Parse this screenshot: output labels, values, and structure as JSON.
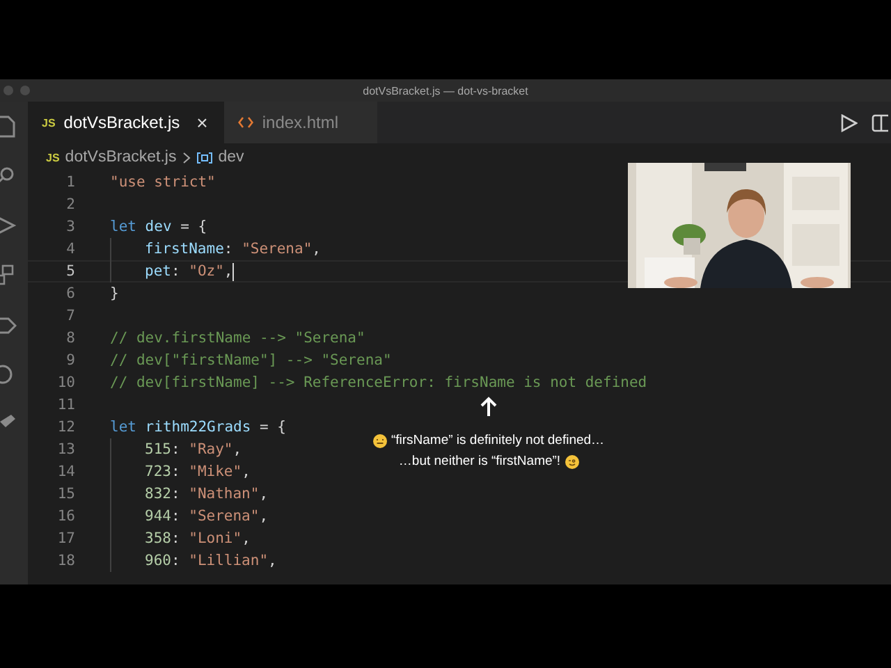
{
  "window": {
    "title": "dotVsBracket.js — dot-vs-bracket"
  },
  "tabs": [
    {
      "icon": "JS",
      "kind": "js",
      "label": "dotVsBracket.js",
      "selected": true,
      "close": "×"
    },
    {
      "kind": "html",
      "label": "index.html",
      "selected": false
    }
  ],
  "breadcrumb": {
    "file_icon": "JS",
    "file": "dotVsBracket.js",
    "symbol": "dev"
  },
  "editor": {
    "lines": [
      {
        "number": "1",
        "current": false,
        "indented": false,
        "tokens": [
          {
            "t": "\"use strict\"",
            "kind": "string"
          }
        ]
      },
      {
        "number": "2",
        "current": false
      },
      {
        "number": "3",
        "current": false,
        "indented": false,
        "tokens": [
          {
            "t": "let ",
            "kind": "keyword"
          },
          {
            "t": "dev",
            "kind": "var"
          },
          {
            "t": " = {",
            "kind": "punct"
          }
        ]
      },
      {
        "number": "4",
        "current": false,
        "indented": true,
        "tokens": [
          {
            "t": "firstName",
            "kind": "var"
          },
          {
            "t": ": ",
            "kind": "punct"
          },
          {
            "t": "\"Serena\"",
            "kind": "string"
          },
          {
            "t": ",",
            "kind": "punct"
          }
        ]
      },
      {
        "number": "5",
        "current": true,
        "indented": true,
        "tokens": [
          {
            "t": "pet",
            "kind": "var"
          },
          {
            "t": ": ",
            "kind": "punct"
          },
          {
            "t": "\"Oz\"",
            "kind": "string"
          },
          {
            "t": ",",
            "kind": "punct"
          }
        ]
      },
      {
        "number": "6",
        "current": false,
        "indented": false,
        "tokens": [
          {
            "t": "}",
            "kind": "punct"
          }
        ]
      },
      {
        "number": "7",
        "current": false
      },
      {
        "number": "8",
        "current": false,
        "indented": false,
        "tokens": [
          {
            "t": "// dev.firstName --> \"Serena\"",
            "kind": "comment"
          }
        ]
      },
      {
        "number": "9",
        "current": false,
        "indented": false,
        "tokens": [
          {
            "t": "// dev[\"firstName\"] --> \"Serena\"",
            "kind": "comment"
          }
        ]
      },
      {
        "number": "10",
        "current": false,
        "indented": false,
        "tokens": [
          {
            "t": "// dev[firstName] --> ReferenceError: firsName is not defined",
            "kind": "comment"
          }
        ]
      },
      {
        "number": "11",
        "current": false
      },
      {
        "number": "12",
        "current": false,
        "indented": false,
        "tokens": [
          {
            "t": "let ",
            "kind": "keyword"
          },
          {
            "t": "rithm22Grads",
            "kind": "var"
          },
          {
            "t": " = {",
            "kind": "punct"
          }
        ]
      },
      {
        "number": "13",
        "current": false,
        "indented": true,
        "tokens": [
          {
            "t": "515",
            "kind": "number"
          },
          {
            "t": ": ",
            "kind": "punct"
          },
          {
            "t": "\"Ray\"",
            "kind": "string"
          },
          {
            "t": ",",
            "kind": "punct"
          }
        ]
      },
      {
        "number": "14",
        "current": false,
        "indented": true,
        "tokens": [
          {
            "t": "723",
            "kind": "number"
          },
          {
            "t": ": ",
            "kind": "punct"
          },
          {
            "t": "\"Mike\"",
            "kind": "string"
          },
          {
            "t": ",",
            "kind": "punct"
          }
        ]
      },
      {
        "number": "15",
        "current": false,
        "indented": true,
        "tokens": [
          {
            "t": "832",
            "kind": "number"
          },
          {
            "t": ": ",
            "kind": "punct"
          },
          {
            "t": "\"Nathan\"",
            "kind": "string"
          },
          {
            "t": ",",
            "kind": "punct"
          }
        ]
      },
      {
        "number": "16",
        "current": false,
        "indented": true,
        "tokens": [
          {
            "t": "944",
            "kind": "number"
          },
          {
            "t": ": ",
            "kind": "punct"
          },
          {
            "t": "\"Serena\"",
            "kind": "string"
          },
          {
            "t": ",",
            "kind": "punct"
          }
        ]
      },
      {
        "number": "17",
        "current": false,
        "indented": true,
        "tokens": [
          {
            "t": "358",
            "kind": "number"
          },
          {
            "t": ": ",
            "kind": "punct"
          },
          {
            "t": "\"Loni\"",
            "kind": "string"
          },
          {
            "t": ",",
            "kind": "punct"
          }
        ]
      },
      {
        "number": "18",
        "current": false,
        "indented": true,
        "tokens": [
          {
            "t": "960",
            "kind": "number"
          },
          {
            "t": ": ",
            "kind": "punct"
          },
          {
            "t": "\"Lillian\"",
            "kind": "string"
          },
          {
            "t": ",",
            "kind": "punct"
          }
        ]
      }
    ]
  },
  "caption": {
    "lines": [
      "“firsName” is definitely not defined…",
      "…but neither is “firstName”!"
    ]
  }
}
